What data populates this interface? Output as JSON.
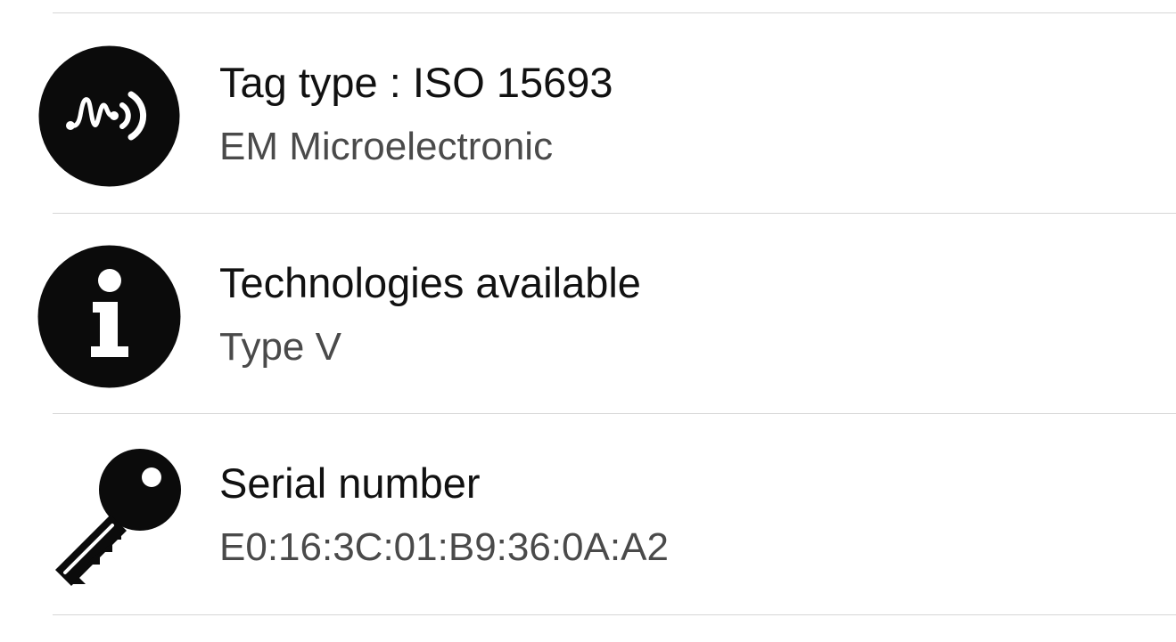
{
  "rows": [
    {
      "icon": "nfc-signal-icon",
      "title": "Tag type : ISO 15693",
      "subtitle": "EM Microelectronic"
    },
    {
      "icon": "info-icon",
      "title": "Technologies available",
      "subtitle": "Type V"
    },
    {
      "icon": "key-icon",
      "title": "Serial number",
      "subtitle": "E0:16:3C:01:B9:36:0A:A2"
    }
  ],
  "colors": {
    "icon": "#0b0b0b",
    "divider": "#d6d6d6",
    "title": "#111111",
    "subtitle": "#4a4a4a",
    "background": "#ffffff"
  }
}
